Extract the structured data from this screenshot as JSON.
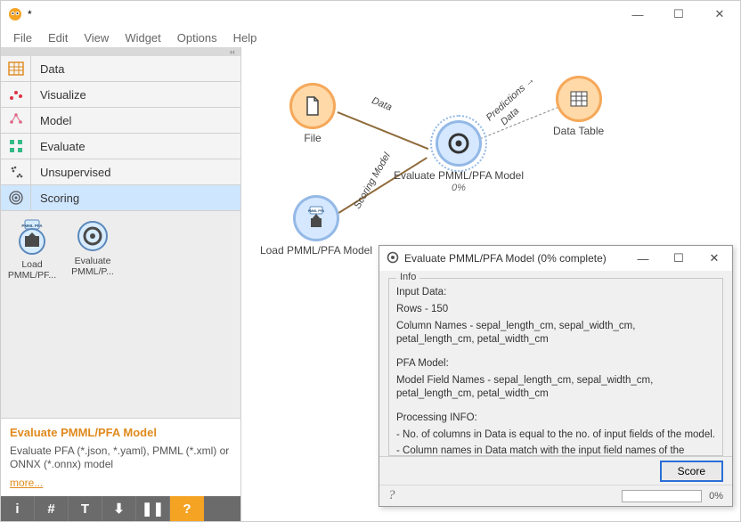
{
  "window": {
    "title": "*",
    "menus": [
      "File",
      "Edit",
      "View",
      "Widget",
      "Options",
      "Help"
    ],
    "win_min": "—",
    "win_max": "☐",
    "win_close": "✕"
  },
  "sidebar": {
    "categories": [
      {
        "label": "Data"
      },
      {
        "label": "Visualize"
      },
      {
        "label": "Model"
      },
      {
        "label": "Evaluate"
      },
      {
        "label": "Unsupervised"
      },
      {
        "label": "Scoring"
      }
    ],
    "widgets": [
      {
        "label": "Load PMML/PF..."
      },
      {
        "label": "Evaluate PMML/P..."
      }
    ]
  },
  "help": {
    "title": "Evaluate PMML/PFA Model",
    "body": "Evaluate PFA (*.json, *.yaml), PMML (*.xml) or ONNX (*.onnx) model",
    "more": "more..."
  },
  "bottombar": {
    "btns": [
      "i",
      "#",
      "T",
      "⬇",
      "❚❚",
      "?"
    ]
  },
  "canvas": {
    "nodes": {
      "file": {
        "label": "File"
      },
      "eval": {
        "label": "Evaluate PMML/PFA Model",
        "pct": "0%"
      },
      "table": {
        "label": "Data Table"
      },
      "load": {
        "label": "Load PMML/PFA Model"
      }
    },
    "edges": {
      "file_eval": "Data",
      "load_eval": "Scoring Model",
      "eval_table_top": "Predictions →",
      "eval_table_bot": "Data"
    }
  },
  "popup": {
    "title": "Evaluate PMML/PFA Model (0% complete)",
    "win_min": "—",
    "win_max": "☐",
    "win_close": "✕",
    "group_title": "Info",
    "p_input_head": "Input Data:",
    "p_input_rows": "Rows - 150",
    "p_input_cols": "Column Names - sepal_length_cm, sepal_width_cm, petal_length_cm, petal_width_cm",
    "p_model_head": "PFA Model:",
    "p_model_fields": "Model Field Names - sepal_length_cm, sepal_width_cm, petal_length_cm, petal_width_cm",
    "p_proc_head": "Processing INFO:",
    "p_proc_1": "- No. of columns in Data is equal to the no. of input fields of the model.",
    "p_proc_2": "- Column names in Data match with the input field names of the model.",
    "score_btn": "Score",
    "footer_pct": "0%",
    "qmark": "?"
  }
}
